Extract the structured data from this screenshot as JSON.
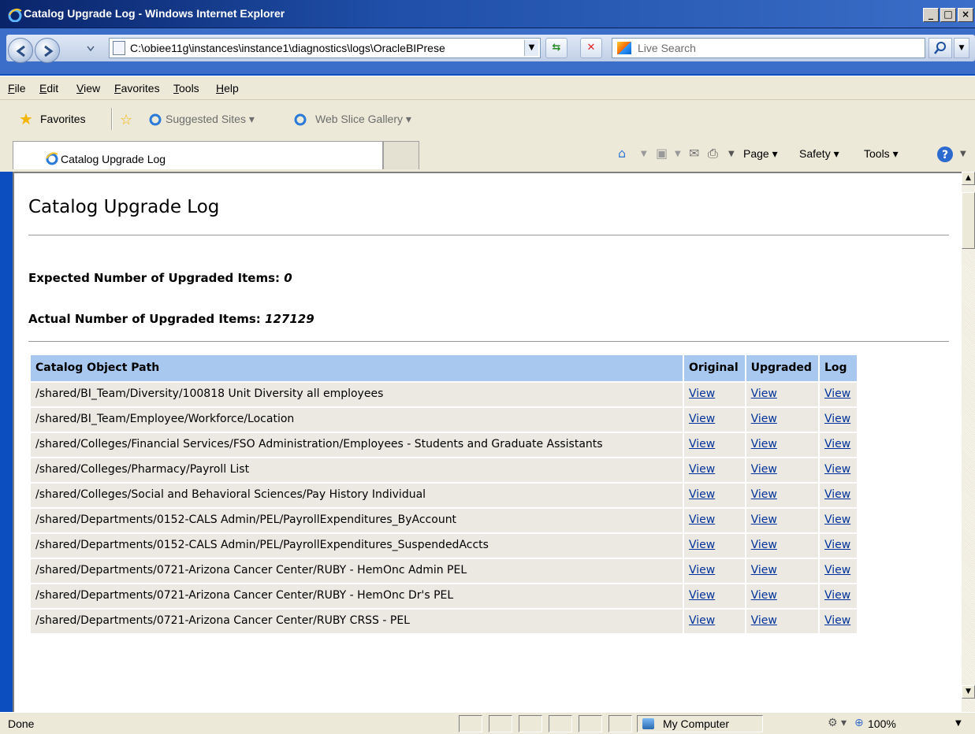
{
  "window": {
    "title": "Catalog Upgrade Log - Windows Internet Explorer",
    "controls": {
      "minimize": "_",
      "maximize": "□",
      "close": "×"
    }
  },
  "address": {
    "url": "C:\\obiee11g\\instances\\instance1\\diagnostics\\logs\\OracleBIPrese",
    "search_placeholder": "Live Search"
  },
  "menu": {
    "items": [
      "File",
      "Edit",
      "View",
      "Favorites",
      "Tools",
      "Help"
    ]
  },
  "favorites_bar": {
    "favorites_label": "Favorites",
    "links": [
      "Suggested Sites ▾",
      "Web Slice Gallery ▾"
    ]
  },
  "tabs": {
    "active_label": "Catalog Upgrade Log"
  },
  "command_bar": {
    "page_label": "Page",
    "safety_label": "Safety",
    "tools_label": "Tools"
  },
  "page": {
    "heading": "Catalog Upgrade Log",
    "expected_label": "Expected Number of Upgraded Items:",
    "expected_value": "0",
    "actual_label": "Actual Number of Upgraded Items:",
    "actual_value": "127129",
    "table": {
      "headers": [
        "Catalog Object Path",
        "Original",
        "Upgraded",
        "Log"
      ],
      "link_label": "View",
      "rows": [
        "/shared/BI_Team/Diversity/100818 Unit Diversity all employees",
        "/shared/BI_Team/Employee/Workforce/Location",
        "/shared/Colleges/Financial Services/FSO Administration/Employees - Students and Graduate Assistants",
        "/shared/Colleges/Pharmacy/Payroll List",
        "/shared/Colleges/Social and Behavioral Sciences/Pay History Individual",
        "/shared/Departments/0152-CALS Admin/PEL/PayrollExpenditures_ByAccount",
        "/shared/Departments/0152-CALS Admin/PEL/PayrollExpenditures_SuspendedAccts",
        "/shared/Departments/0721-Arizona Cancer Center/RUBY - HemOnc Admin PEL",
        "/shared/Departments/0721-Arizona Cancer Center/RUBY - HemOnc Dr's PEL",
        "/shared/Departments/0721-Arizona Cancer Center/RUBY CRSS - PEL"
      ]
    }
  },
  "status": {
    "text": "Done",
    "zone": "My Computer",
    "zoom": "100%"
  },
  "colors": {
    "title_bar": "#0a246a",
    "header_cell": "#a9c8ef",
    "row_cell": "#ece9e3",
    "link": "#003399"
  },
  "icons": [
    "ie-icon",
    "back-icon",
    "forward-icon",
    "refresh-icon",
    "stop-icon",
    "search-icon",
    "star-icon",
    "home-icon",
    "feeds-icon",
    "mail-icon",
    "print-icon",
    "help-icon",
    "globe-icon"
  ]
}
